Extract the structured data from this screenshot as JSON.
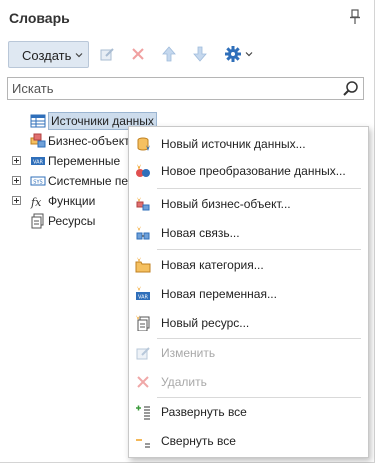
{
  "panel": {
    "title": "Словарь"
  },
  "toolbar": {
    "create_label": "Создать"
  },
  "search": {
    "placeholder": "Искать"
  },
  "tree": {
    "items": [
      {
        "label": "Источники данных"
      },
      {
        "label": "Бизнес-объекты"
      },
      {
        "label": "Переменные"
      },
      {
        "label": "Системные пер"
      },
      {
        "label": "Функции"
      },
      {
        "label": "Ресурсы"
      }
    ]
  },
  "menu": {
    "items": [
      {
        "label": "Новый источник данных...",
        "icon": "new-datasource-icon"
      },
      {
        "label": "Новое преобразование данных...",
        "icon": "new-transformation-icon"
      },
      {
        "label": "Новый бизнес-объект...",
        "icon": "new-business-object-icon"
      },
      {
        "label": "Новая связь...",
        "icon": "new-relation-icon"
      },
      {
        "label": "Новая категория...",
        "icon": "new-category-icon"
      },
      {
        "label": "Новая переменная...",
        "icon": "new-variable-icon"
      },
      {
        "label": "Новый ресурс...",
        "icon": "new-resource-icon"
      },
      {
        "label": "Изменить",
        "icon": "edit-icon",
        "disabled": true
      },
      {
        "label": "Удалить",
        "icon": "delete-icon",
        "disabled": true
      },
      {
        "label": "Развернуть все",
        "icon": "expand-all-icon"
      },
      {
        "label": "Свернуть все",
        "icon": "collapse-all-icon"
      }
    ]
  },
  "colors": {
    "accent": "#2f6fba",
    "selection": "#cddcec",
    "delete_red": "#e05050",
    "disabled_text": "#a8a8a8",
    "star": "#f0a020"
  }
}
